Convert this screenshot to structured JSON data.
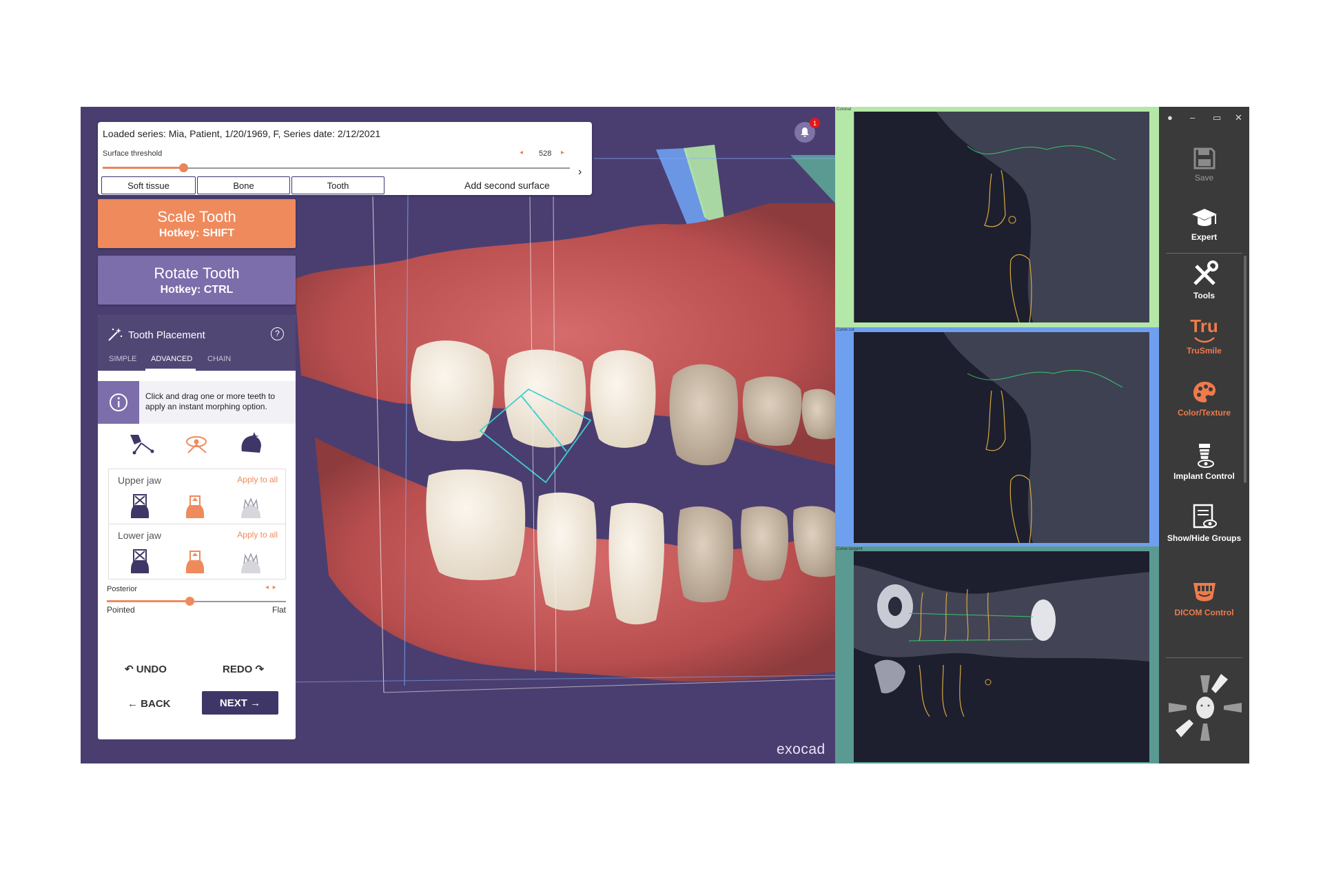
{
  "series": {
    "title": "Loaded series:  Mia, Patient, 1/20/1969, F, Series date: 2/12/2021",
    "threshold_label": "Surface threshold",
    "threshold_value": "528",
    "buttons": [
      "Soft tissue",
      "Bone",
      "Tooth"
    ],
    "add_second": "Add second surface"
  },
  "actions": {
    "scale": {
      "title": "Scale Tooth",
      "hotkey": "Hotkey: SHIFT"
    },
    "rotate": {
      "title": "Rotate Tooth",
      "hotkey": "Hotkey: CTRL"
    }
  },
  "tooth_placement": {
    "title": "Tooth Placement",
    "help": "?",
    "tabs": [
      "SIMPLE",
      "ADVANCED",
      "CHAIN"
    ],
    "active_tab": "ADVANCED",
    "info": "Click and drag one or more teeth to apply an instant morphing option.",
    "upper_jaw": {
      "label": "Upper jaw",
      "apply": "Apply to all"
    },
    "lower_jaw": {
      "label": "Lower jaw",
      "apply": "Apply to all"
    },
    "posterior": {
      "label": "Posterior",
      "left": "Pointed",
      "right": "Flat",
      "value": 0.46
    },
    "undo": "UNDO",
    "redo": "REDO",
    "back": "BACK",
    "next": "NEXT"
  },
  "slices": [
    {
      "label": "Coronal",
      "bg": "#b4e8a8"
    },
    {
      "label": "Curve cut",
      "bg": "#6fa0ef"
    },
    {
      "label": "Curve tangent",
      "bg": "#5b9a92"
    }
  ],
  "notifications": {
    "count": "1"
  },
  "brand": "exocad",
  "toolbar": {
    "items": [
      {
        "label": "Save",
        "icon": "save-icon",
        "color": "#9a9a9a"
      },
      {
        "label": "Expert",
        "icon": "graduation-cap-icon",
        "color": "#ffffff"
      },
      {
        "label": "Tools",
        "icon": "tools-icon",
        "color": "#ffffff"
      },
      {
        "label": "TruSmile",
        "icon": "trusmile-icon",
        "color": "#ef7b4c"
      },
      {
        "label": "Color/Texture",
        "icon": "palette-icon",
        "color": "#ef7b4c"
      },
      {
        "label": "Implant Control",
        "icon": "implant-icon",
        "color": "#ffffff"
      },
      {
        "label": "Show/Hide Groups",
        "icon": "groups-icon",
        "color": "#ffffff"
      },
      {
        "label": "DICOM Control",
        "icon": "dicom-icon",
        "color": "#ef7b4c"
      }
    ],
    "trusmile_logo": "Tru"
  },
  "colors": {
    "accent": "#ef8a5c",
    "purple": "#7c6dab",
    "dark_purple": "#514775"
  }
}
